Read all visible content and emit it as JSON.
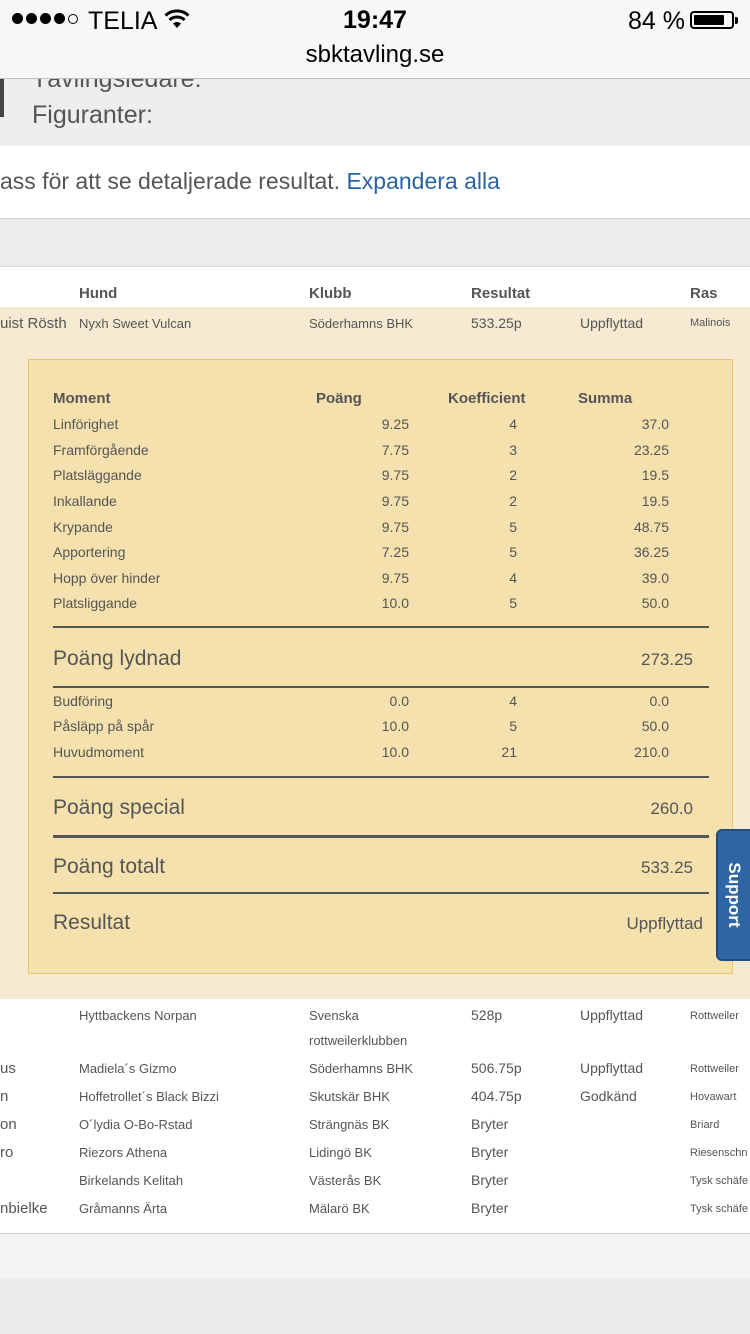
{
  "status": {
    "carrier": "TELIA",
    "time": "19:47",
    "battery_pct": "84 %",
    "battery_level": 0.84
  },
  "browser": {
    "url": "sbktavling.se"
  },
  "page": {
    "partial_label_top": "Tävlingsledare:",
    "figuranter_label": "Figuranter:",
    "info_text": "ass för att se detaljerade resultat.",
    "expand_link": "Expandera alla"
  },
  "table": {
    "headers": {
      "hund": "Hund",
      "klubb": "Klubb",
      "resultat": "Resultat",
      "ras": "Ras"
    },
    "selected": {
      "handler": "uist Rösth",
      "dog": "Nyxh Sweet Vulcan",
      "club": "Söderhamns BHK",
      "points": "533.25p",
      "status": "Uppflyttad",
      "breed": "Malinois"
    },
    "detail": {
      "headers": {
        "moment": "Moment",
        "poang": "Poäng",
        "koefficient": "Koefficient",
        "summa": "Summa"
      },
      "lydnad_rows": [
        {
          "moment": "Linförighet",
          "poang": "9.25",
          "koef": "4",
          "summa": "37.0"
        },
        {
          "moment": "Framförgående",
          "poang": "7.75",
          "koef": "3",
          "summa": "23.25"
        },
        {
          "moment": "Platsläggande",
          "poang": "9.75",
          "koef": "2",
          "summa": "19.5"
        },
        {
          "moment": "Inkallande",
          "poang": "9.75",
          "koef": "2",
          "summa": "19.5"
        },
        {
          "moment": "Krypande",
          "poang": "9.75",
          "koef": "5",
          "summa": "48.75"
        },
        {
          "moment": "Apportering",
          "poang": "7.25",
          "koef": "5",
          "summa": "36.25"
        },
        {
          "moment": "Hopp över hinder",
          "poang": "9.75",
          "koef": "4",
          "summa": "39.0"
        },
        {
          "moment": "Platsliggande",
          "poang": "10.0",
          "koef": "5",
          "summa": "50.0"
        }
      ],
      "poang_lydnad": {
        "label": "Poäng lydnad",
        "value": "273.25"
      },
      "special_rows": [
        {
          "moment": "Budföring",
          "poang": "0.0",
          "koef": "4",
          "summa": "0.0"
        },
        {
          "moment": "Påsläpp på spår",
          "poang": "10.0",
          "koef": "5",
          "summa": "50.0"
        },
        {
          "moment": "Huvudmoment",
          "poang": "10.0",
          "koef": "21",
          "summa": "210.0"
        }
      ],
      "poang_special": {
        "label": "Poäng special",
        "value": "260.0"
      },
      "poang_totalt": {
        "label": "Poäng totalt",
        "value": "533.25"
      },
      "resultat": {
        "label": "Resultat",
        "value": "Uppflyttad"
      }
    },
    "other_rows": [
      {
        "handler": "",
        "dog": "Hyttbackens Norpan",
        "club": "Svenska",
        "club_line2": "rottweilerklubben",
        "points": "528p",
        "status": "Uppflyttad",
        "breed": "Rottweiler"
      },
      {
        "handler": "us",
        "dog": "Madiela´s Gizmo",
        "club": "Söderhamns BHK",
        "club_line2": "",
        "points": "506.75p",
        "status": "Uppflyttad",
        "breed": "Rottweiler"
      },
      {
        "handler": "n",
        "dog": "Hoffetrollet´s Black Bizzi",
        "club": "Skutskär BHK",
        "club_line2": "",
        "points": "404.75p",
        "status": "Godkänd",
        "breed": "Hovawart"
      },
      {
        "handler": "on",
        "dog": "O´lydia O-Bo-Rstad",
        "club": "Strängnäs BK",
        "club_line2": "",
        "points": "Bryter",
        "status": "",
        "breed": "Briard"
      },
      {
        "handler": "ro",
        "dog": "Riezors Athena",
        "club": "Lidingö BK",
        "club_line2": "",
        "points": "Bryter",
        "status": "",
        "breed": "Riesenschn"
      },
      {
        "handler": "",
        "dog": "Birkelands Kelitah",
        "club": "Västerås BK",
        "club_line2": "",
        "points": "Bryter",
        "status": "",
        "breed": "Tysk schäfe"
      },
      {
        "handler": "nbielke",
        "dog": "Gråmanns Ärta",
        "club": "Mälarö BK",
        "club_line2": "",
        "points": "Bryter",
        "status": "",
        "breed": "Tysk schäfe"
      }
    ]
  },
  "support": {
    "label": "Support"
  }
}
